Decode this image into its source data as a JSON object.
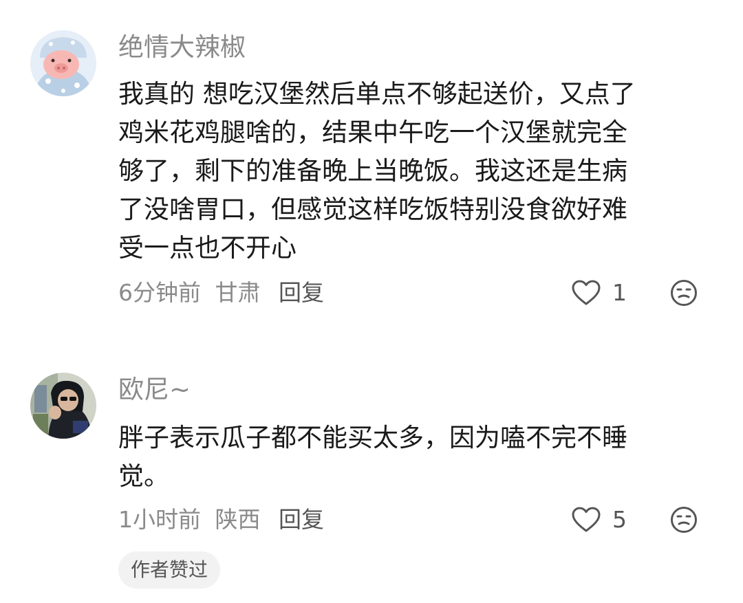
{
  "comments": [
    {
      "username": "绝情大辣椒",
      "avatar": "pig-avatar",
      "lines": [
        "我真的 想吃汉堡然后单点不够起送价，又点了",
        "鸡米花鸡腿啥的，结果中午吃一个汉堡就完全",
        "够了，剩下的准备晚上当晚饭。我这还是生病",
        "了没啥胃口，但感觉这样吃饭特别没食欲好难",
        "受一点也不开心"
      ],
      "time": "6分钟前",
      "location": "甘肃",
      "reply_label": "回复",
      "likes": "1",
      "icons": {
        "like": "heart-outline-icon",
        "react": "neutral-face-icon"
      }
    },
    {
      "username": "欧尼~",
      "avatar": "person-photo-avatar",
      "lines": [
        "胖子表示瓜子都不能买太多，因为嗑不完不睡",
        "觉。"
      ],
      "time": "1小时前",
      "location": "陕西",
      "reply_label": "回复",
      "likes": "5",
      "icons": {
        "like": "heart-outline-icon",
        "react": "neutral-face-icon"
      },
      "badge": "作者赞过"
    }
  ],
  "colors": {
    "text": "#1a1a1a",
    "muted": "#8a8a8a",
    "badge_bg": "#f2f2f2"
  }
}
